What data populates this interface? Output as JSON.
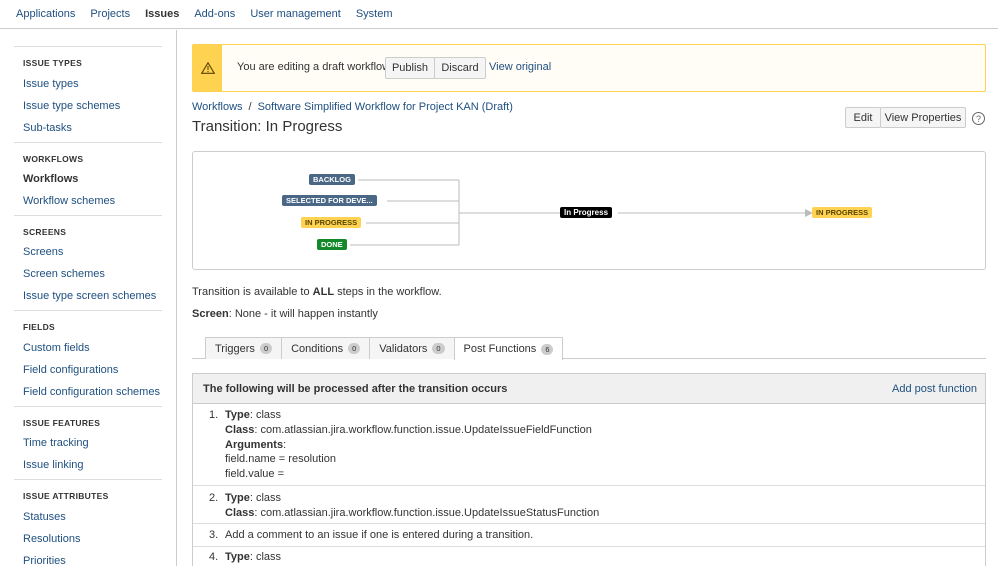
{
  "topnav": {
    "items": [
      "Applications",
      "Projects",
      "Issues",
      "Add-ons",
      "User management",
      "System"
    ],
    "active": "Issues"
  },
  "sidebar": {
    "sections": [
      {
        "heading": "ISSUE TYPES",
        "items": [
          "Issue types",
          "Issue type schemes",
          "Sub-tasks"
        ]
      },
      {
        "heading": "WORKFLOWS",
        "items": [
          "Workflows",
          "Workflow schemes"
        ]
      },
      {
        "heading": "SCREENS",
        "items": [
          "Screens",
          "Screen schemes",
          "Issue type screen schemes"
        ]
      },
      {
        "heading": "FIELDS",
        "items": [
          "Custom fields",
          "Field configurations",
          "Field configuration schemes"
        ]
      },
      {
        "heading": "ISSUE FEATURES",
        "items": [
          "Time tracking",
          "Issue linking"
        ]
      },
      {
        "heading": "ISSUE ATTRIBUTES",
        "items": [
          "Statuses",
          "Resolutions",
          "Priorities"
        ]
      }
    ],
    "current": "Workflows"
  },
  "banner": {
    "message": "You are editing a draft workflow.",
    "publish": "Publish",
    "discard": "Discard",
    "view_original": "View original",
    "warning_icon": "warning-icon",
    "accent": "#ffd351"
  },
  "breadcrumb": {
    "root": "Workflows",
    "separator": "/",
    "current": "Software Simplified Workflow for Project KAN (Draft)"
  },
  "title": "Transition: In Progress",
  "actions": {
    "edit": "Edit",
    "view_properties": "View Properties",
    "help": "?"
  },
  "diagram": {
    "from_statuses": [
      "BACKLOG",
      "SELECTED FOR DEVE...",
      "IN PROGRESS",
      "DONE"
    ],
    "transition": "In Progress",
    "to_status": "IN PROGRESS"
  },
  "availability": {
    "prefix": "Transition is available to ",
    "emph": "ALL",
    "suffix": " steps in the workflow."
  },
  "screen": {
    "label": "Screen",
    "value": ": None - it will happen instantly"
  },
  "tabs": [
    {
      "label": "Triggers",
      "count": "0"
    },
    {
      "label": "Conditions",
      "count": "0"
    },
    {
      "label": "Validators",
      "count": "0"
    },
    {
      "label": "Post Functions",
      "count": "6"
    }
  ],
  "post_functions": {
    "heading": "The following will be processed after the transition occurs",
    "add_label": "Add post function",
    "rows": [
      {
        "num": "1.",
        "type_label": "Type",
        "type_value": ": class",
        "class_label": "Class",
        "class_value": ": com.atlassian.jira.workflow.function.issue.UpdateIssueFieldFunction",
        "args_label": "Arguments",
        "args_colon": ":",
        "arg1": "field.name = resolution",
        "arg2": "field.value ="
      },
      {
        "num": "2.",
        "type_label": "Type",
        "type_value": ": class",
        "class_label": "Class",
        "class_value": ": com.atlassian.jira.workflow.function.issue.UpdateIssueStatusFunction"
      },
      {
        "num": "3.",
        "text": "Add a comment to an issue if one is entered during a transition."
      },
      {
        "num": "4.",
        "type_label": "Type",
        "type_value": ": class"
      }
    ]
  }
}
